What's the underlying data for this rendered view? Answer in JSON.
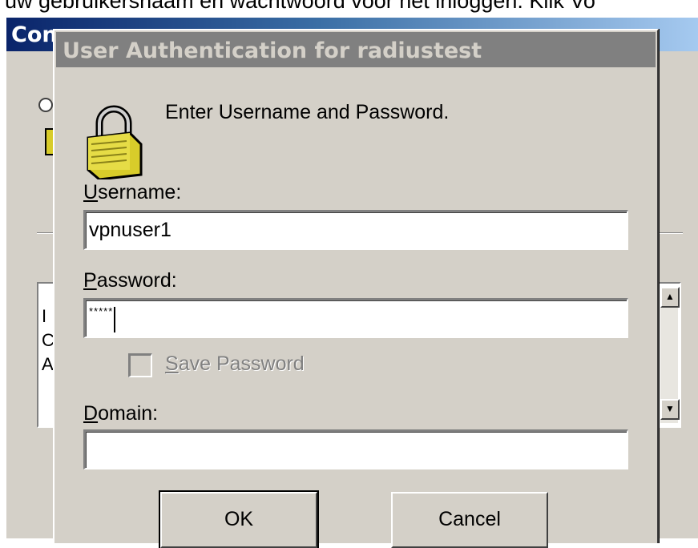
{
  "caption": {
    "text": "uw gebruikersnaam en wachtwoord voor het inloggen. Klik Vo"
  },
  "background_window": {
    "title": "Con",
    "list_lines": [
      "I",
      "C",
      "A"
    ]
  },
  "dialog": {
    "title": "User Authentication for radiustest",
    "prompt": "Enter Username and Password.",
    "username_label": "Username:",
    "username_value": "vpnuser1",
    "password_label": "Password:",
    "password_mask": "*****",
    "save_password_label": "Save Password",
    "domain_label": "Domain:",
    "domain_value": "",
    "ok_label": "OK",
    "cancel_label": "Cancel"
  },
  "icons": {
    "lock": "padlock-icon"
  },
  "colors": {
    "dialog_bg": "#d4d0c8",
    "inactive_titlebar": "#808080",
    "active_titlebar_start": "#0a246a",
    "active_titlebar_end": "#a6caf0",
    "padlock": "#d8cc2a"
  }
}
